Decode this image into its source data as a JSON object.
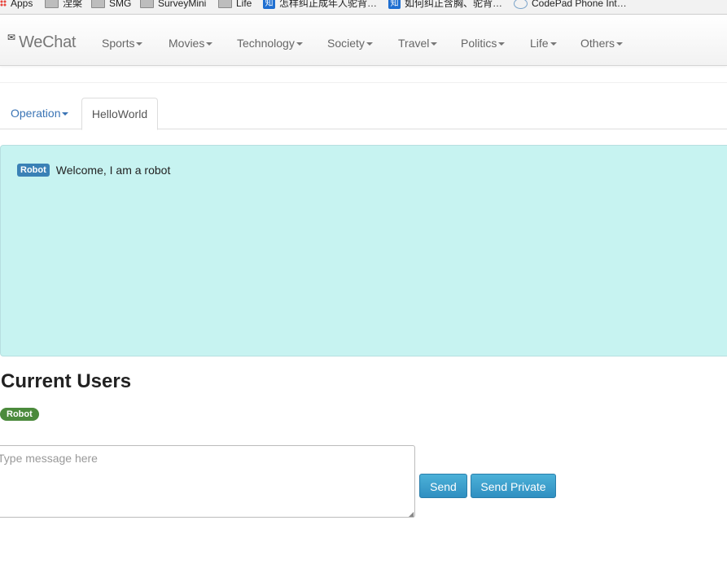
{
  "bookmarks": {
    "items": [
      {
        "label": "Apps",
        "icon": "apps-grid-icon"
      },
      {
        "label": "涅槃",
        "icon": "folder-icon"
      },
      {
        "label": "SMG",
        "icon": "folder-icon"
      },
      {
        "label": "SurveyMini",
        "icon": "folder-icon"
      },
      {
        "label": "Life",
        "icon": "folder-icon"
      },
      {
        "label": "怎样纠正成年人驼背…",
        "icon": "zhihu-icon"
      },
      {
        "label": "如何纠正含胸、驼背…",
        "icon": "zhihu-icon"
      },
      {
        "label": "CodePad Phone Int…",
        "icon": "codepad-icon"
      }
    ],
    "zhihu_glyph": "知"
  },
  "navbar": {
    "brand_icon": "envelope-icon",
    "brand_icon_glyph": "✉",
    "brand": "WeChat",
    "items": [
      {
        "label": "Sports"
      },
      {
        "label": "Movies"
      },
      {
        "label": "Technology"
      },
      {
        "label": "Society"
      },
      {
        "label": "Travel"
      },
      {
        "label": "Politics"
      },
      {
        "label": "Life"
      },
      {
        "label": "Others"
      }
    ]
  },
  "tabs": {
    "operation": "Operation",
    "helloworld": "HelloWorld"
  },
  "chat": {
    "messages": [
      {
        "sender": "Robot",
        "text": "Welcome, I am a robot"
      }
    ]
  },
  "users": {
    "title": "Current Users",
    "list": [
      "Robot"
    ]
  },
  "composer": {
    "placeholder": "Type message here",
    "send_label": "Send",
    "send_private_label": "Send Private"
  },
  "colors": {
    "chat_bg": "#c7f3f1",
    "label_blue": "#3a81b6",
    "badge_green": "#4b8a3c",
    "button_blue": "#3a9dcb",
    "link_blue": "#3a74b5"
  }
}
